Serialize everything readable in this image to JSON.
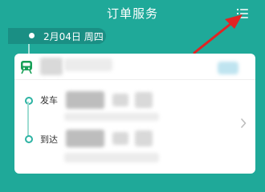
{
  "header": {
    "title": "订单服务",
    "menu_icon": "list-menu-icon"
  },
  "date_bar": {
    "date_text": "2月04日 周四"
  },
  "ticket_card": {
    "train_icon": "train-icon",
    "depart_label": "发车",
    "arrive_label": "到达",
    "chevron_icon": "chevron-right-icon"
  },
  "colors": {
    "header_bg": "#1fa999",
    "accent": "#2db3a3",
    "train_icon_green": "#18a058",
    "annotation_arrow": "#e02424"
  }
}
